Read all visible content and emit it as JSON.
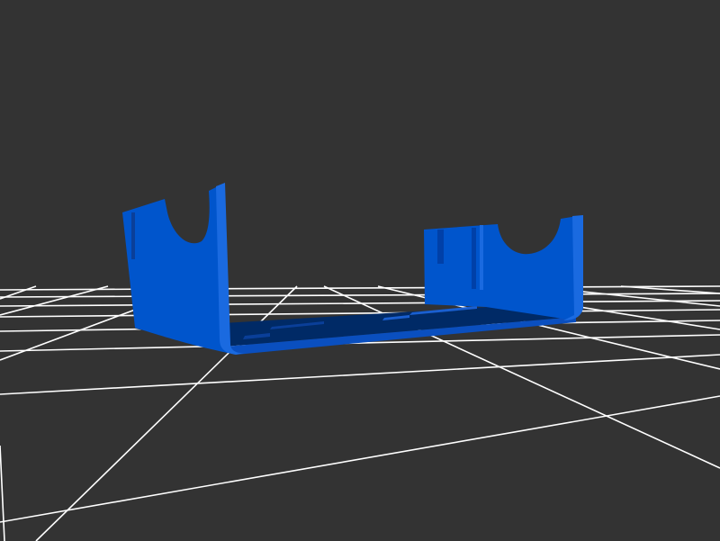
{
  "scene": {
    "background_color": "#333333",
    "grid_color": "#ffffff",
    "model_color": "#0055cc",
    "model_shadow_color": "#002a66",
    "model_highlight_color": "#1a6ae0",
    "model": "u-shaped-bracket"
  }
}
